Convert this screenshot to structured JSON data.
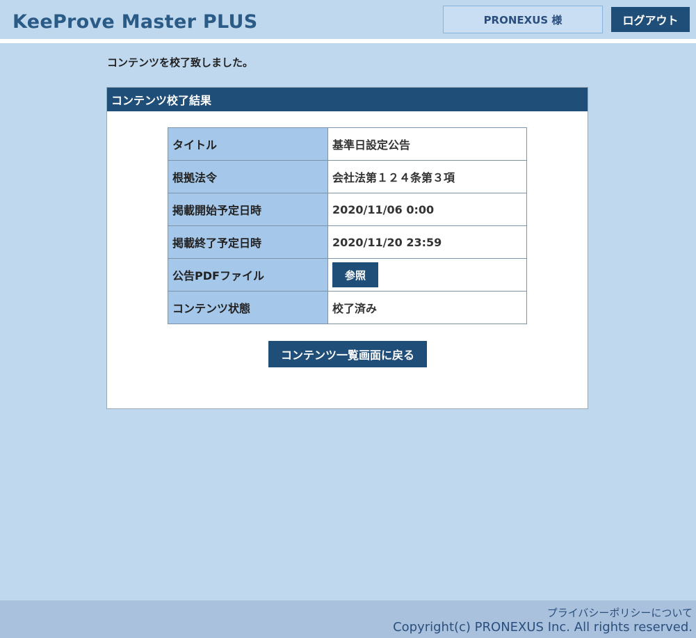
{
  "header": {
    "app_title": "KeeProve Master PLUS",
    "user_label": "PRONEXUS 様",
    "logout_label": "ログアウト"
  },
  "message": "コンテンツを校了致しました。",
  "panel": {
    "title": "コンテンツ校了結果",
    "rows": [
      {
        "label": "タイトル",
        "value": "基準日設定公告"
      },
      {
        "label": "根拠法令",
        "value": "会社法第１２４条第３項"
      },
      {
        "label": "掲載開始予定日時",
        "value": "2020/11/06 0:00"
      },
      {
        "label": "掲載終了予定日時",
        "value": "2020/11/20 23:59"
      },
      {
        "label": "公告PDFファイル",
        "button_label": "参照"
      },
      {
        "label": "コンテンツ状態",
        "value": "校了済み"
      }
    ],
    "back_button_label": "コンテンツ一覧画面に戻る"
  },
  "footer": {
    "privacy_link": "プライバシーポリシーについて",
    "copyright": "Copyright(c) PRONEXUS Inc. All rights reserved."
  },
  "colors": {
    "page_bg": "#bfd8ee",
    "accent": "#1f4e79",
    "label_cell_bg": "#a5c8ea",
    "footer_bg": "#a9c1dc"
  }
}
